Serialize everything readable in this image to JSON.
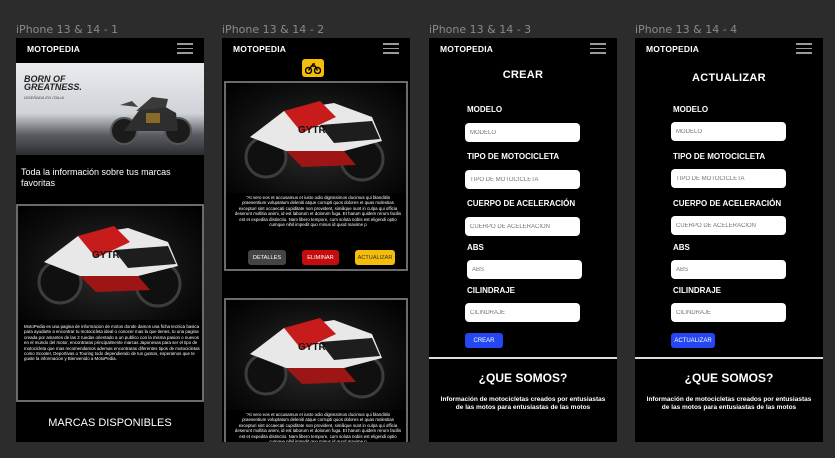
{
  "frames": [
    {
      "label": "iPhone 13 & 14 - 1"
    },
    {
      "label": "iPhone 13 & 14 - 2"
    },
    {
      "label": "iPhone 13 & 14 - 3"
    },
    {
      "label": "iPhone 13 & 14 - 4"
    }
  ],
  "header": {
    "brand": "MOTOPEDIA",
    "menu_icon": "hamburger-icon"
  },
  "home": {
    "hero_slogan": "BORN OF GREATNESS.",
    "hero_sub": "DISEÑADA EN ITALIA",
    "intro": "Toda la información sobre tus marcas favoritas",
    "description": "MotoPedia es una pagina de informacion de motos donde damos una ficha tecnica basica para ayudarte a encontrar tu motocicleta ideal o conocer mas la que tienes, tu una pagina creada por amantes de las 2 ruedas orientado a un publico con la misma pasion o nuevos en el mundo del motor, encontraras principalmente marcas Japonesas para ser el tipo de motocicleta que mas recomendamos ademas encontraras diferentes tipos de motocicletas como Scooter, Deportivas o Touring todo dependiendo de tus gustos, esperamos que te guste la informacion y Bienvenido a MotoPedia.",
    "brands_title": "MARCAS DISPONIBLES"
  },
  "catalog": {
    "moto_icon": "motorcycle-icon",
    "body_text": "\"At vero eos et accusamus et iusto odio dignissimos ducimus qui blanditiis praesentium voluptatum deleniti atque corrupti quos dolores et quas molestias excepturi sint occaecati cupiditate non provident, similique sunt in culpa qui officia deserunt mollitia animi, id est laborum et dolorum fuga. Et harum quidem rerum facilis est et expedita distinctio. Nam libero tempore, cum soluta nobis est eligendi optio cumque nihil impedit quo minus id quod maxime p",
    "buttons": {
      "details": "DETALLES",
      "delete": "ELIMINAR",
      "update": "ACTUALIZAR"
    },
    "colors": {
      "details": "#444444",
      "delete": "#c40e0e",
      "update": "#f5bd0a"
    }
  },
  "create": {
    "title": "CREAR",
    "fields": [
      {
        "label": "MODELO",
        "placeholder": "MODELO"
      },
      {
        "label": "TIPO DE MOTOCICLETA",
        "placeholder": "TIPO DE MOTOCICLETA"
      },
      {
        "label": "CUERPO DE ACELERACIÓN",
        "placeholder": "CUERPO DE ACELERACIÓN"
      },
      {
        "label": "ABS",
        "placeholder": "ABS"
      },
      {
        "label": "CILINDRAJE",
        "placeholder": "CILINDRAJE"
      }
    ],
    "submit": "CREAR"
  },
  "update": {
    "title": "ACTUALIZAR",
    "fields": [
      {
        "label": "MODELO",
        "placeholder": "MODELO"
      },
      {
        "label": "TIPO DE MOTOCICLETA",
        "placeholder": "TIPO DE MOTOCICLETA"
      },
      {
        "label": "CUERPO DE ACELERACIÓN",
        "placeholder": "CUERPO DE ACELERACIÓN"
      },
      {
        "label": "ABS",
        "placeholder": "ABS"
      },
      {
        "label": "CILINDRAJE",
        "placeholder": "CILINDRAJE"
      }
    ],
    "submit": "ACTUALIZAR"
  },
  "about": {
    "title": "¿QUE SOMOS?",
    "text": "Información de motocicletas creados por entusiastas de las motos para entusiastas de las motos"
  },
  "colors": {
    "accent_blue": "#2447f2",
    "accent_yellow": "#f5bd0a",
    "danger": "#c40e0e"
  }
}
